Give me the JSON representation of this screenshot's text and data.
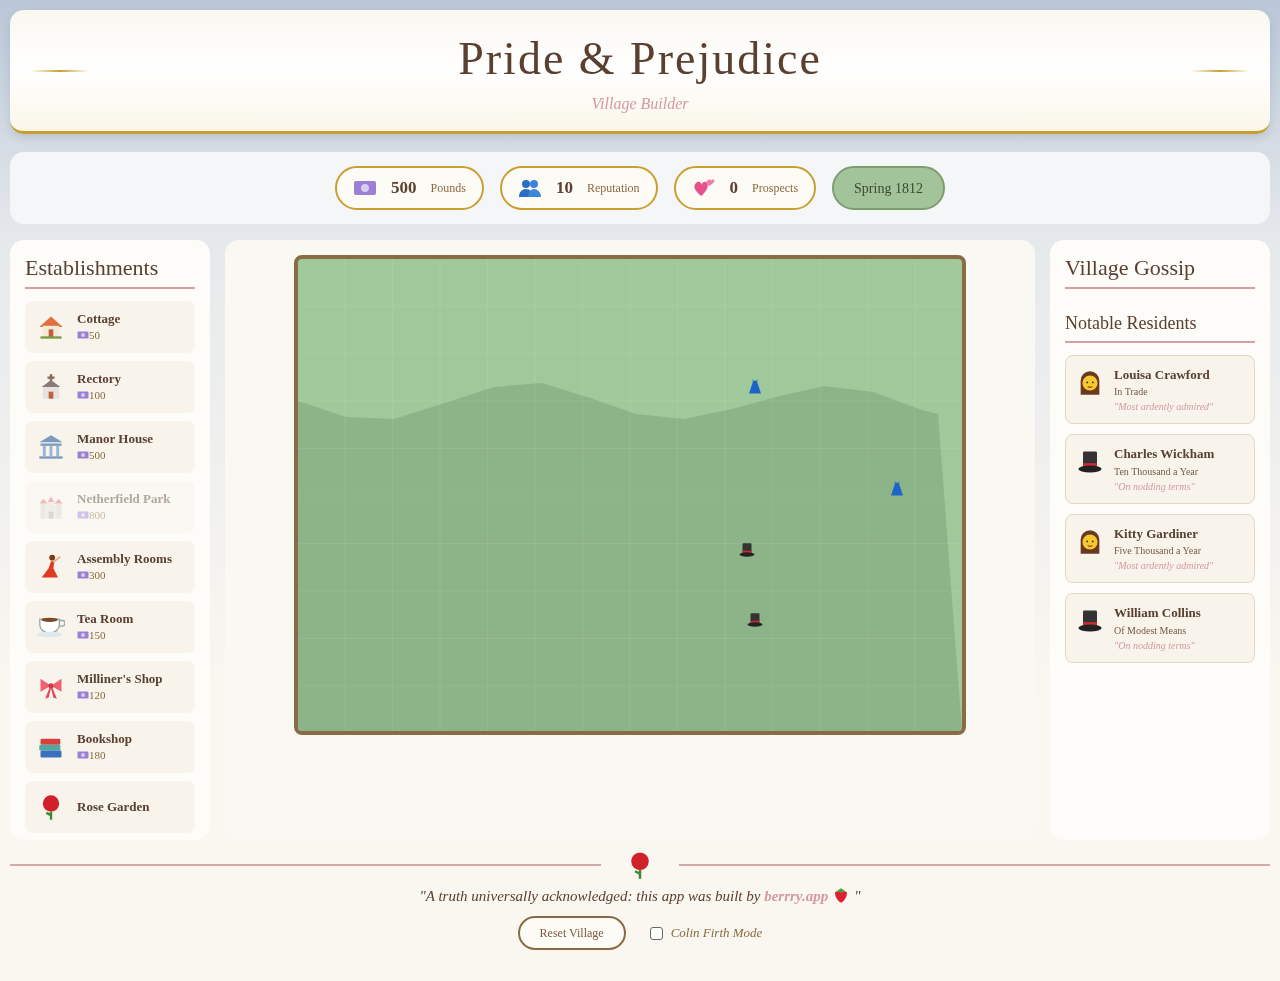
{
  "header": {
    "title": "Pride & Prejudice",
    "subtitle": "Village Builder"
  },
  "stats": [
    {
      "kind": "money",
      "value": "500",
      "label": "Pounds"
    },
    {
      "kind": "people",
      "value": "10",
      "label": "Reputation"
    },
    {
      "kind": "hearts",
      "value": "0",
      "label": "Prospects"
    }
  ],
  "season": "Spring 1812",
  "establishments": {
    "title": "Establishments",
    "items": [
      {
        "kind": "cottage",
        "name": "Cottage",
        "cost": "50",
        "disabled": false
      },
      {
        "kind": "church",
        "name": "Rectory",
        "cost": "100",
        "disabled": false
      },
      {
        "kind": "manor",
        "name": "Manor House",
        "cost": "500",
        "disabled": false
      },
      {
        "kind": "castle",
        "name": "Netherfield Park",
        "cost": "800",
        "disabled": true
      },
      {
        "kind": "dancer",
        "name": "Assembly Rooms",
        "cost": "300",
        "disabled": false
      },
      {
        "kind": "tea",
        "name": "Tea Room",
        "cost": "150",
        "disabled": false
      },
      {
        "kind": "bow",
        "name": "Milliner's Shop",
        "cost": "120",
        "disabled": false
      },
      {
        "kind": "books",
        "name": "Bookshop",
        "cost": "180",
        "disabled": false
      },
      {
        "kind": "rose",
        "name": "Rose Garden",
        "disabled": false
      }
    ]
  },
  "gossip": {
    "title": "Village Gossip",
    "residents_title": "Notable Residents",
    "residents": [
      {
        "kind": "lady",
        "name": "Louisa Crawford",
        "standing": "In Trade",
        "opinion": "\"Most ardently admired\""
      },
      {
        "kind": "gentleman",
        "name": "Charles Wickham",
        "standing": "Ten Thousand a Year",
        "opinion": "\"On nodding terms\""
      },
      {
        "kind": "lady",
        "name": "Kitty Gardiner",
        "standing": "Five Thousand a Year",
        "opinion": "\"Most ardently admired\""
      },
      {
        "kind": "gentleman",
        "name": "William Collins",
        "standing": "Of Modest Means",
        "opinion": "\"On nodding terms\""
      }
    ]
  },
  "footer": {
    "quote_before": "\"A truth universally acknowledged: this app was built by ",
    "link": "berrry.app",
    "quote_after": "\"",
    "reset_button": "Reset Village",
    "colin_firth_mode": {
      "label": "Colin Firth Mode",
      "checked": false
    }
  }
}
